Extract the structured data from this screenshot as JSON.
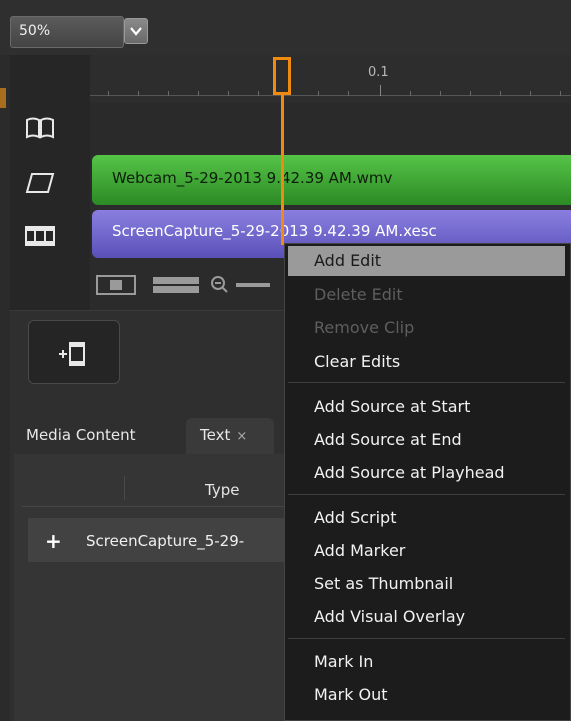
{
  "zoom": {
    "value": "50%"
  },
  "ruler": {
    "label": "0.1"
  },
  "tracks": {
    "webcam_clip": "Webcam_5-29-2013 9.42.39 AM.wmv",
    "screen_clip": "ScreenCapture_5-29-2013 9.42.39 AM.xesc"
  },
  "tabs": {
    "media_content": "Media Content",
    "text": "Text",
    "text_close": "×"
  },
  "list": {
    "column_type": "Type",
    "row_plus": "+",
    "row_name": "ScreenCapture_5-29-"
  },
  "context_menu": {
    "items": [
      "Add Edit",
      "Delete Edit",
      "Remove Clip",
      "Clear Edits",
      "Add Source at Start",
      "Add Source at End",
      "Add Source at Playhead",
      "Add Script",
      "Add Marker",
      "Set as Thumbnail",
      "Add Visual Overlay",
      "Mark In",
      "Mark Out"
    ]
  },
  "colors": {
    "playhead": "#f08a10",
    "webcam_track": "#3fa835",
    "screen_track": "#7066cc",
    "menu_highlight": "#9a9a9a"
  },
  "icons": {
    "zoom_arrow": "chevron-down-icon",
    "track_1": "book-icon",
    "track_2": "layer-icon",
    "track_3": "film-strip-icon",
    "add_media": "add-media-icon"
  }
}
